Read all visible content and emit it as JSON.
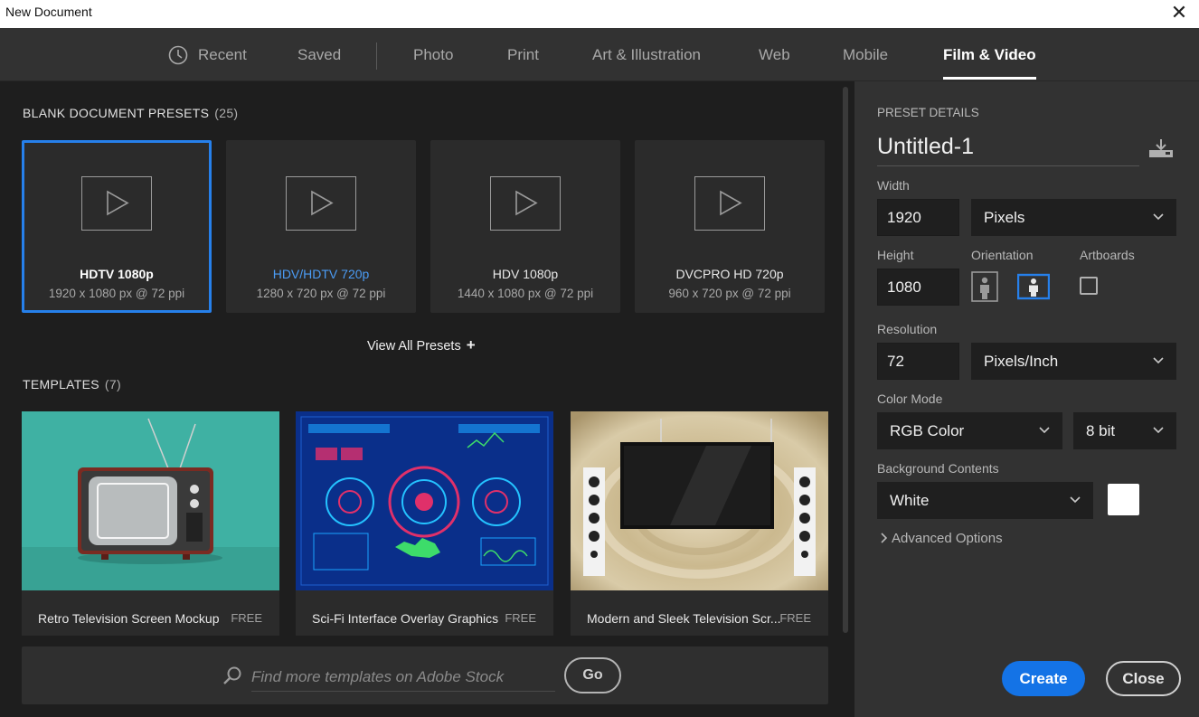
{
  "window": {
    "title": "New Document",
    "close_glyph": "✕"
  },
  "tabs": [
    {
      "label": "Recent"
    },
    {
      "label": "Saved"
    },
    {
      "label": "Photo"
    },
    {
      "label": "Print"
    },
    {
      "label": "Art & Illustration"
    },
    {
      "label": "Web"
    },
    {
      "label": "Mobile"
    },
    {
      "label": "Film & Video",
      "active": true
    }
  ],
  "blank_presets": {
    "heading": "BLANK DOCUMENT PRESETS",
    "count": "(25)",
    "items": [
      {
        "name": "HDTV 1080p",
        "dims": "1920 x 1080 px @ 72 ppi",
        "selected": true
      },
      {
        "name": "HDV/HDTV 720p",
        "dims": "1280 x 720 px @ 72 ppi"
      },
      {
        "name": "HDV 1080p",
        "dims": "1440 x 1080 px @ 72 ppi"
      },
      {
        "name": "DVCPRO HD 720p",
        "dims": "960 x 720 px @ 72 ppi"
      }
    ],
    "view_all_label": "View All Presets",
    "view_all_glyph": "+"
  },
  "templates": {
    "heading": "TEMPLATES",
    "count": "(7)",
    "items": [
      {
        "name": "Retro Television Screen Mockup",
        "price": "FREE"
      },
      {
        "name": "Sci-Fi Interface Overlay Graphics",
        "price": "FREE"
      },
      {
        "name": "Modern and Sleek Television Scr...",
        "price": "FREE"
      }
    ]
  },
  "stock": {
    "placeholder": "Find more templates on Adobe Stock",
    "go_label": "Go"
  },
  "details": {
    "heading": "PRESET DETAILS",
    "doc_name": "Untitled-1",
    "width_label": "Width",
    "width_value": "1920",
    "width_unit": "Pixels",
    "height_label": "Height",
    "height_value": "1080",
    "orientation_label": "Orientation",
    "artboards_label": "Artboards",
    "resolution_label": "Resolution",
    "resolution_value": "72",
    "resolution_unit": "Pixels/Inch",
    "color_mode_label": "Color Mode",
    "color_mode": "RGB Color",
    "bit_depth": "8 bit",
    "background_label": "Background Contents",
    "background": "White",
    "advanced_label": "Advanced Options",
    "create_label": "Create",
    "close_label": "Close"
  },
  "colors": {
    "accent": "#2680eb",
    "link_blue": "#4b9cf5",
    "create_blue": "#1473e6",
    "panel": "#323232",
    "background": "#1e1e1e"
  },
  "icons": [
    "clock-icon",
    "play-icon",
    "search-icon",
    "save-preset-icon",
    "chevron-down-icon",
    "portrait-icon",
    "landscape-icon",
    "chevron-right-icon",
    "close-icon"
  ]
}
